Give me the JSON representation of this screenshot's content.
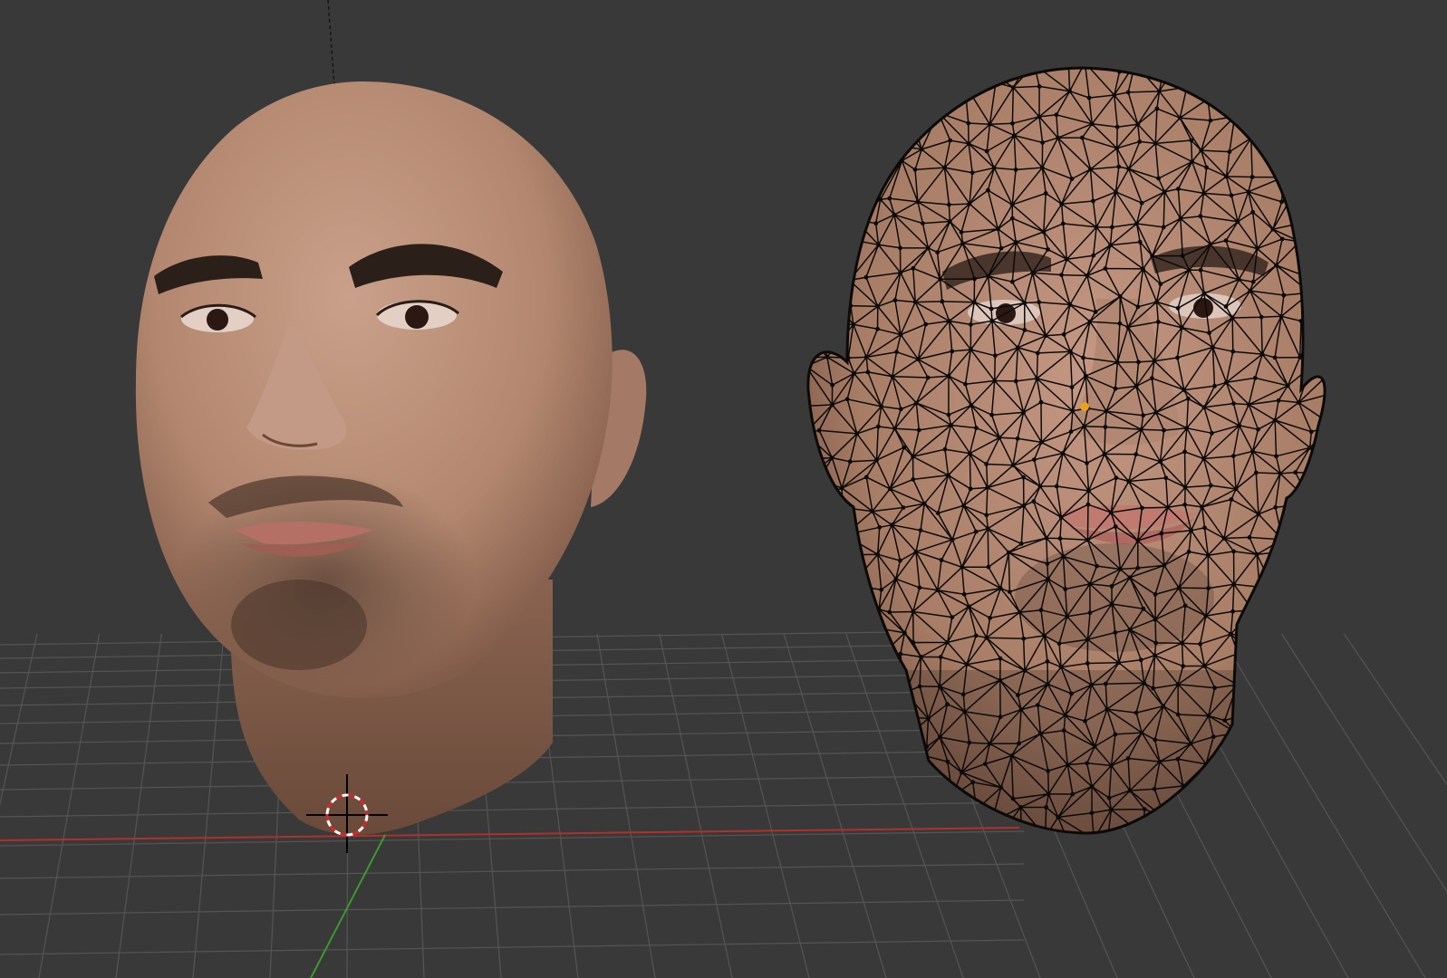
{
  "app": "3D viewport",
  "scene": {
    "background_color": "#393939",
    "grid_color": "#5a5a5a",
    "x_axis_color": "#b0302c",
    "y_axis_color": "#3a9a30",
    "objects": [
      {
        "name": "head-shaded",
        "mode": "solid",
        "skin_color": "#b88c76"
      },
      {
        "name": "head-wireframe",
        "mode": "textured-wireframe",
        "skin_color": "#b68a73",
        "wire_color": "#0c0a09",
        "selected_vertex_color": "#e8a020"
      }
    ],
    "cursor_3d": {
      "ring_colors": [
        "#d62828",
        "#ffffff"
      ]
    }
  }
}
